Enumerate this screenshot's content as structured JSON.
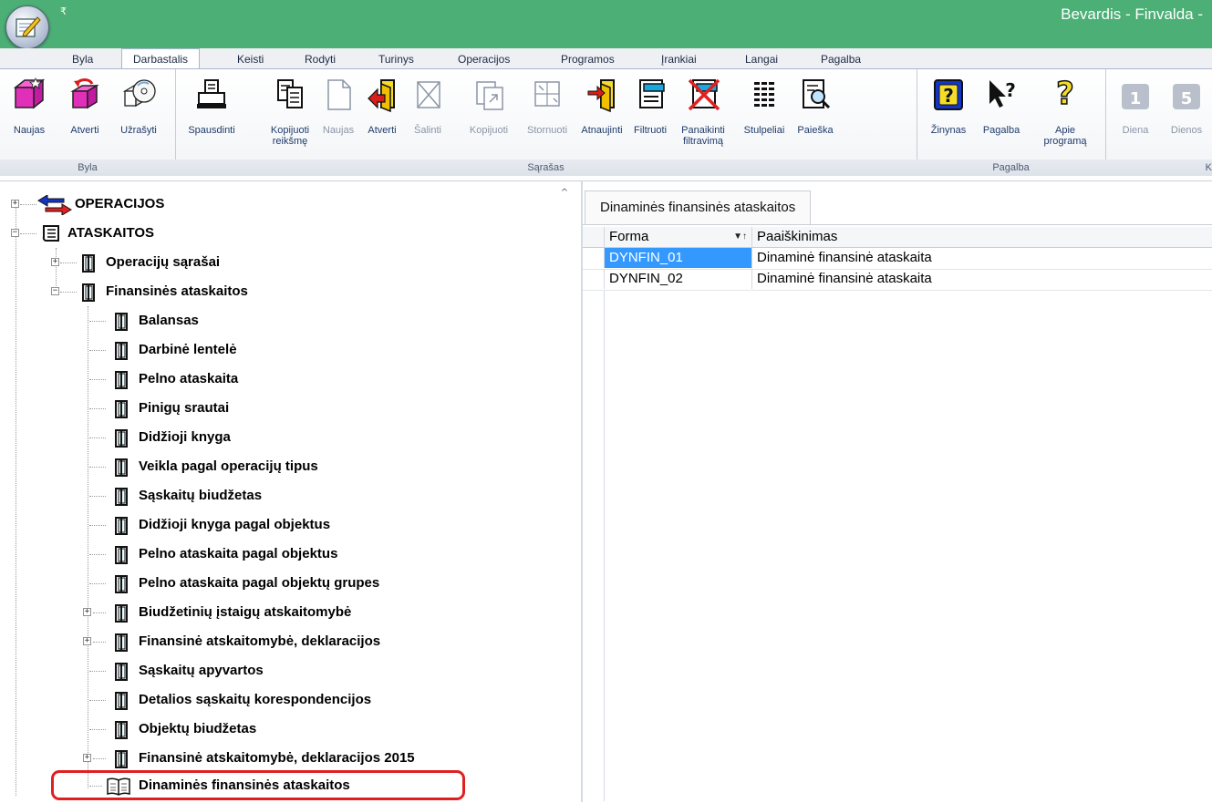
{
  "window": {
    "title": "Bevardis - Finvalda -",
    "qat_glyph": "₹"
  },
  "menu_tabs": [
    {
      "label": "Byla"
    },
    {
      "label": "Darbastalis"
    },
    {
      "label": "Keisti"
    },
    {
      "label": "Rodyti"
    },
    {
      "label": "Turinys"
    },
    {
      "label": "Operacijos"
    },
    {
      "label": "Programos"
    },
    {
      "label": "Įrankiai"
    },
    {
      "label": "Langai"
    },
    {
      "label": "Pagalba"
    }
  ],
  "ribbon": {
    "groups": [
      {
        "label": "Byla"
      },
      {
        "label": "Sąrašas"
      },
      {
        "label": "Pagalba"
      },
      {
        "label": "K"
      }
    ],
    "buttons": [
      {
        "label": "Naujas",
        "icon": "new-document-icon"
      },
      {
        "label": "Atverti",
        "icon": "open-icon"
      },
      {
        "label": "Užrašyti",
        "icon": "save-icon"
      },
      {
        "label": "Spausdinti",
        "icon": "print-icon"
      },
      {
        "label": "Kopijuoti",
        "label2": "reikšmę",
        "icon": "copy-value-icon"
      },
      {
        "label": "Naujas",
        "icon": "blank-page-icon"
      },
      {
        "label": "Atverti",
        "icon": "open-record-icon"
      },
      {
        "label": "Šalinti",
        "icon": "delete-icon"
      },
      {
        "label": "Kopijuoti",
        "icon": "copy-icon"
      },
      {
        "label": "Stornuoti",
        "icon": "storno-icon"
      },
      {
        "label": "Atnaujinti",
        "icon": "refresh-icon"
      },
      {
        "label": "Filtruoti",
        "icon": "filter-icon"
      },
      {
        "label": "Panaikinti",
        "label2": "filtravimą",
        "icon": "clear-filter-icon"
      },
      {
        "label": "Stulpeliai",
        "icon": "columns-icon"
      },
      {
        "label": "Paieška",
        "icon": "search-icon"
      },
      {
        "label": "Žinynas",
        "icon": "help-book-icon"
      },
      {
        "label": "Pagalba",
        "icon": "context-help-icon"
      },
      {
        "label": "Apie",
        "label2": "programą",
        "icon": "about-icon"
      },
      {
        "label": "Diena",
        "icon": "day-calendar-icon",
        "badge": "1"
      },
      {
        "label": "Dienos",
        "icon": "days-calendar-icon",
        "badge": "5"
      }
    ]
  },
  "tree": {
    "nodes": [
      {
        "label": "OPERACIJOS"
      },
      {
        "label": "ATASKAITOS"
      },
      {
        "label": "Operacijų sąrašai"
      },
      {
        "label": "Finansinės ataskaitos"
      },
      {
        "label": "Balansas"
      },
      {
        "label": "Darbinė lentelė"
      },
      {
        "label": "Pelno ataskaita"
      },
      {
        "label": "Pinigų srautai"
      },
      {
        "label": "Didžioji knyga"
      },
      {
        "label": "Veikla pagal operacijų tipus"
      },
      {
        "label": "Sąskaitų biudžetas"
      },
      {
        "label": "Didžioji knyga pagal objektus"
      },
      {
        "label": "Pelno ataskaita pagal objektus"
      },
      {
        "label": "Pelno ataskaita pagal objektų grupes"
      },
      {
        "label": "Biudžetinių įstaigų atskaitomybė"
      },
      {
        "label": "Finansinė atskaitomybė, deklaracijos"
      },
      {
        "label": "Sąskaitų apyvartos"
      },
      {
        "label": "Detalios sąskaitų korespondencijos"
      },
      {
        "label": "Objektų biudžetas"
      },
      {
        "label": "Finansinė atskaitomybė, deklaracijos 2015"
      },
      {
        "label": "Dinaminės finansinės ataskaitos"
      }
    ]
  },
  "right_pane": {
    "tab_label": "Dinaminės finansinės ataskaitos",
    "columns": [
      "Forma",
      "Paaiškinimas"
    ],
    "sort_glyph": "▼↑",
    "rows": [
      [
        "DYNFIN_01",
        "Dinaminė finansinė ataskaita"
      ],
      [
        "DYNFIN_02",
        "Dinaminė finansinė ataskaita"
      ]
    ]
  },
  "colors": {
    "title_bar": "#4caf75",
    "selection": "#3399ff",
    "highlight": "#e02020"
  }
}
